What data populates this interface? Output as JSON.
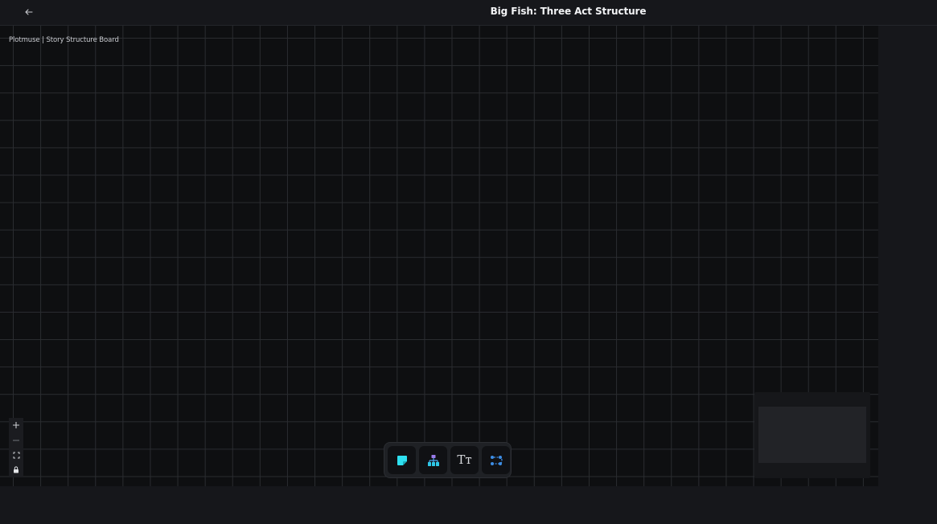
{
  "header": {
    "title": "Big Fish: Three Act Structure",
    "back_icon": "arrow-left-icon"
  },
  "board": {
    "label": "Plotmuse | Story Structure Board"
  },
  "zoom_controls": {
    "items": [
      "zoom-in-icon",
      "zoom-out-icon",
      "fit-view-icon",
      "lock-icon"
    ]
  },
  "toolbar": {
    "tools": [
      {
        "name": "sticky-note-tool",
        "icon": "sticky-note-icon"
      },
      {
        "name": "hierarchy-tool",
        "icon": "hierarchy-icon"
      },
      {
        "name": "text-tool",
        "icon": "text-icon",
        "label": "Tт"
      },
      {
        "name": "connector-tool",
        "icon": "flow-connector-icon"
      }
    ]
  },
  "colors": {
    "accent_cyan": "#2ee0f0",
    "accent_blue": "#3d8ee6",
    "background": "#0e0f11",
    "chrome": "#16171b"
  }
}
